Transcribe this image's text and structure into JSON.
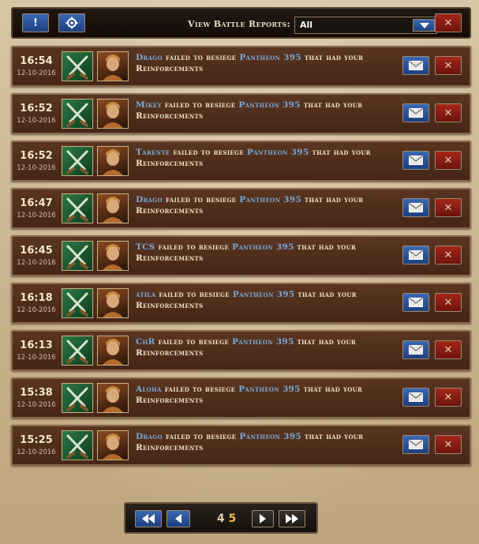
{
  "toolbar": {
    "info_label": "!",
    "filter_label": "View Battle Reports:",
    "filter_value": "All",
    "close_label": "✕"
  },
  "reports": [
    {
      "time": "16:54",
      "date": "12-10-2016",
      "attacker": "Drago",
      "action": "failed to besiege",
      "target": "Pantheon 395",
      "suffix": "that had your Reinforcements",
      "avatar": "warrior-avatar-icon"
    },
    {
      "time": "16:52",
      "date": "12-10-2016",
      "attacker": "Mikey",
      "action": "failed to besiege",
      "target": "Pantheon 395",
      "suffix": "that had your Reinforcements",
      "avatar": "warrior-avatar-icon"
    },
    {
      "time": "16:52",
      "date": "12-10-2016",
      "attacker": "Tarente",
      "action": "failed to besiege",
      "target": "Pantheon 395",
      "suffix": "that had your Reinforcements",
      "avatar": "huntress-avatar-icon"
    },
    {
      "time": "16:47",
      "date": "12-10-2016",
      "attacker": "Drago",
      "action": "failed to besiege",
      "target": "Pantheon 395",
      "suffix": "that had your Reinforcements",
      "avatar": "warrior-avatar-icon"
    },
    {
      "time": "16:45",
      "date": "12-10-2016",
      "attacker": "TCS",
      "action": "failed to besiege",
      "target": "Pantheon 395",
      "suffix": "that had your Reinforcements",
      "avatar": "sorceress-avatar-icon"
    },
    {
      "time": "16:18",
      "date": "12-10-2016",
      "attacker": "atila",
      "action": "failed to besiege",
      "target": "Pantheon 395",
      "suffix": "that had your Reinforcements",
      "avatar": "knight-avatar-icon"
    },
    {
      "time": "16:13",
      "date": "12-10-2016",
      "attacker": "ChR",
      "action": "failed to besiege",
      "target": "Pantheon 395",
      "suffix": "that had your Reinforcements",
      "avatar": "mage-avatar-icon"
    },
    {
      "time": "15:38",
      "date": "12-10-2016",
      "attacker": "Aloha",
      "action": "failed to besiege",
      "target": "Pantheon 395",
      "suffix": "that had your Reinforcements",
      "avatar": "queen-avatar-icon"
    },
    {
      "time": "15:25",
      "date": "12-10-2016",
      "attacker": "Drago",
      "action": "failed to besiege",
      "target": "Pantheon 395",
      "suffix": "that had your Reinforcements",
      "avatar": "warrior-avatar-icon"
    }
  ],
  "pagination": {
    "current_page": "4",
    "total_pages": "5"
  },
  "colors": {
    "link": "#79a9d8",
    "row_bg": "#4e2d1c",
    "accent_red": "#a52619",
    "accent_blue": "#2a559a"
  }
}
